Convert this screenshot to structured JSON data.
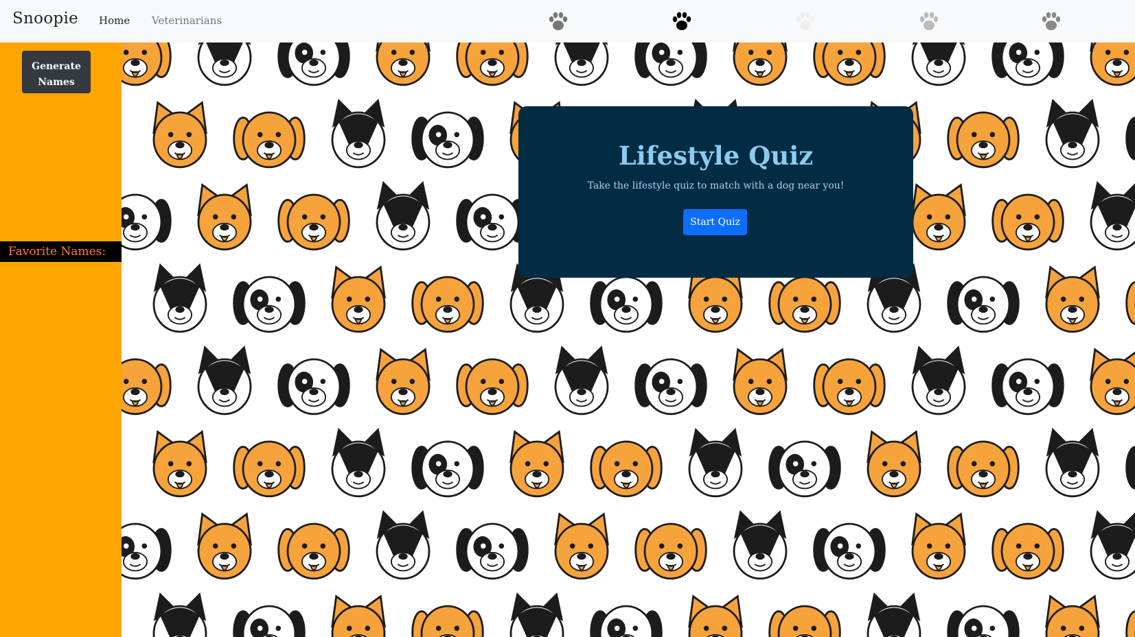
{
  "navbar": {
    "brand": "Snoopie",
    "links": [
      {
        "label": "Home",
        "active": true
      },
      {
        "label": "Veterinarians",
        "active": false
      }
    ],
    "paw_icons": [
      {
        "name": "paw-icon",
        "color": "#777777"
      },
      {
        "name": "paw-icon",
        "color": "#000000"
      },
      {
        "name": "paw-icon",
        "color": "#eeeeee"
      },
      {
        "name": "paw-icon",
        "color": "#bbbbbb"
      },
      {
        "name": "paw-icon",
        "color": "#888888"
      }
    ]
  },
  "sidebar": {
    "generate_button": "Generate Names",
    "favorites_label": "Favorite Names:",
    "background": "#ffa500"
  },
  "quiz_card": {
    "title": "Lifestyle Quiz",
    "subtitle": "Take the lifestyle quiz to match with a dog near you!",
    "button": "Start Quiz",
    "background": "#022c43",
    "title_color": "#8ccbf0"
  },
  "background_pattern": {
    "icon": "dog-faces-pattern",
    "colors": [
      "#f6a33c",
      "#1c1c1c",
      "#ffffff"
    ]
  }
}
